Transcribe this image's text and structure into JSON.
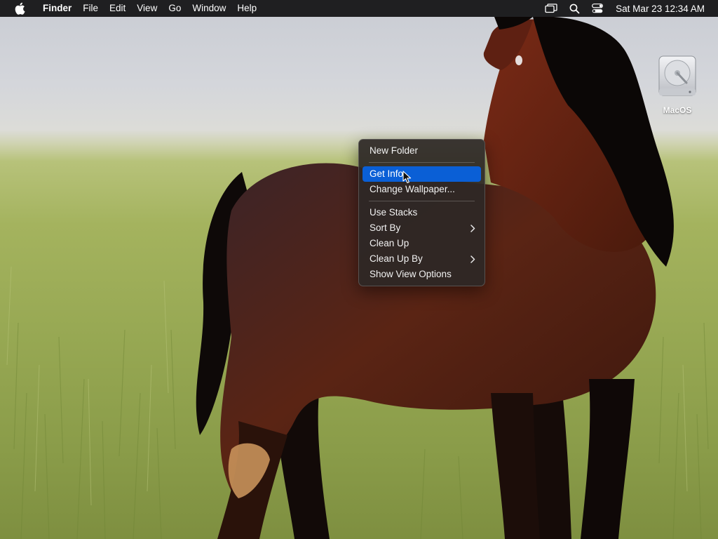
{
  "menubar": {
    "apple_icon": "apple-logo-icon",
    "items": [
      {
        "label": "Finder",
        "bold": true
      },
      {
        "label": "File"
      },
      {
        "label": "Edit"
      },
      {
        "label": "View"
      },
      {
        "label": "Go"
      },
      {
        "label": "Window"
      },
      {
        "label": "Help"
      }
    ],
    "status_icons": [
      "screen-mirroring-icon",
      "spotlight-search-icon",
      "control-center-icon"
    ],
    "clock": "Sat Mar 23  12:34 AM"
  },
  "desktop": {
    "wallpaper": "horse-in-grass-field",
    "icons": [
      {
        "label": "MacOS",
        "icon": "hard-disk-icon"
      }
    ]
  },
  "context_menu": {
    "sections": [
      [
        {
          "label": "New Folder"
        }
      ],
      [
        {
          "label": "Get Info",
          "selected": true
        },
        {
          "label": "Change Wallpaper..."
        }
      ],
      [
        {
          "label": "Use Stacks"
        },
        {
          "label": "Sort By",
          "submenu": true
        },
        {
          "label": "Clean Up"
        },
        {
          "label": "Clean Up By",
          "submenu": true
        },
        {
          "label": "Show View Options"
        }
      ]
    ],
    "selected_color": "#0a5fd6"
  },
  "colors": {
    "menubar_bg": "#1f1f21",
    "menu_bg": "#2d2826",
    "accent": "#0a5fd6"
  }
}
